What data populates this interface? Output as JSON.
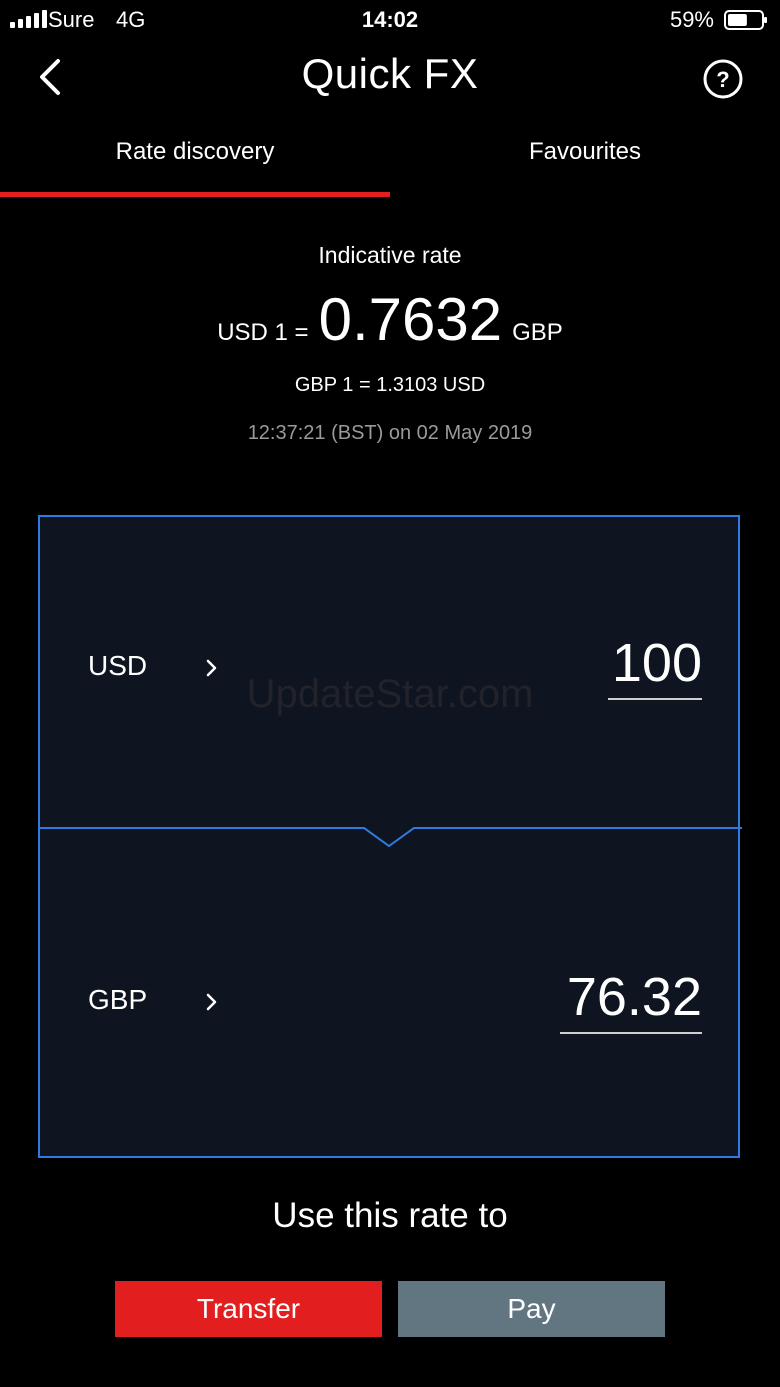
{
  "status_bar": {
    "carrier": "Sure",
    "network": "4G",
    "time": "14:02",
    "battery_percent": "59%",
    "battery_level": 0.59
  },
  "header": {
    "title": "Quick FX",
    "back_icon": "chevron-left-icon",
    "help_icon": "question-circle-icon"
  },
  "tabs": [
    {
      "label": "Rate discovery",
      "active": true
    },
    {
      "label": "Favourites",
      "active": false
    }
  ],
  "colors": {
    "accent_red": "#e31e1e",
    "converter_border": "#2f7be0",
    "converter_bg": "#0e1520",
    "pay_button": "#627682"
  },
  "rate": {
    "heading": "Indicative rate",
    "prefix": "USD 1 =",
    "value": "0.7632",
    "suffix": "GBP",
    "inverse": "GBP 1 = 1.3103 USD",
    "timestamp": "12:37:21 (BST) on 02 May 2019"
  },
  "converter": {
    "from": {
      "currency": "USD",
      "amount": "100"
    },
    "to": {
      "currency": "GBP",
      "amount": "76.32"
    },
    "watermark": "UpdateStar.com"
  },
  "actions": {
    "heading": "Use this rate to",
    "transfer_label": "Transfer",
    "pay_label": "Pay"
  }
}
